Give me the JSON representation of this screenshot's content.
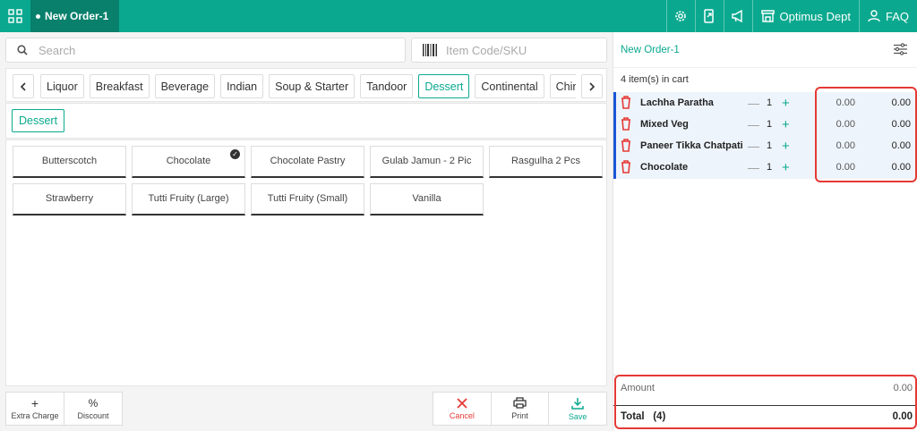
{
  "topbar": {
    "tab_label": "New Order-1",
    "dept_label": "Optimus Dept",
    "faq_label": "FAQ",
    "accent_color": "#0aa98f",
    "tab_color": "#08806c"
  },
  "search": {
    "placeholder": "Search"
  },
  "sku": {
    "placeholder": "Item Code/SKU"
  },
  "categories": [
    {
      "label": "Liquor"
    },
    {
      "label": "Breakfast"
    },
    {
      "label": "Beverage"
    },
    {
      "label": "Indian"
    },
    {
      "label": "Soup & Starter"
    },
    {
      "label": "Tandoor"
    },
    {
      "label": "Dessert",
      "active": true
    },
    {
      "label": "Continental"
    },
    {
      "label": "Chinese"
    }
  ],
  "subcategory": {
    "label": "Dessert"
  },
  "items": [
    {
      "label": "Butterscotch"
    },
    {
      "label": "Chocolate",
      "selected": true
    },
    {
      "label": "Chocolate Pastry"
    },
    {
      "label": "Gulab Jamun - 2 Pic"
    },
    {
      "label": "Rasgulha 2 Pcs"
    },
    {
      "label": "Strawberry"
    },
    {
      "label": "Tutti Fruity (Large)"
    },
    {
      "label": "Tutti Fruity (Small)"
    },
    {
      "label": "Vanilla"
    }
  ],
  "bottom_left": {
    "extra_charge": "Extra Charge",
    "discount": "Discount",
    "discount_icon": "%"
  },
  "bottom_right": {
    "cancel": "Cancel",
    "print": "Print",
    "save": "Save"
  },
  "order": {
    "title": "New Order-1",
    "cart_count": "4 item(s) in cart",
    "lines": [
      {
        "name": "Lachha Paratha",
        "qty": "1",
        "price": "0.00",
        "total": "0.00"
      },
      {
        "name": "Mixed Veg",
        "qty": "1",
        "price": "0.00",
        "total": "0.00"
      },
      {
        "name": "Paneer Tikka Chatpati",
        "qty": "1",
        "price": "0.00",
        "total": "0.00"
      },
      {
        "name": "Chocolate",
        "qty": "1",
        "price": "0.00",
        "total": "0.00"
      }
    ],
    "amount_label": "Amount",
    "amount_value": "0.00",
    "total_label": "Total",
    "total_count": "(4)",
    "total_value": "0.00"
  }
}
